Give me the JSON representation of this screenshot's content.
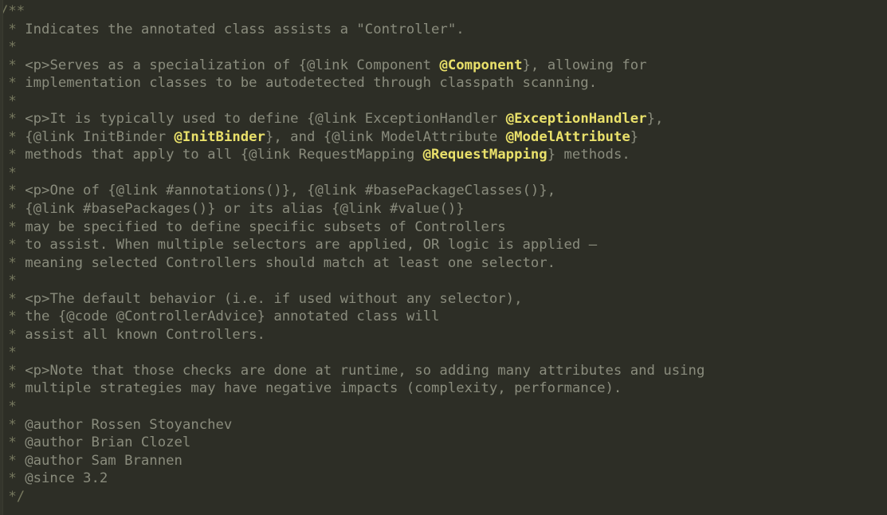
{
  "editor": {
    "kind": "code-editor-javadoc-comment",
    "language": "Java",
    "theme": "dark",
    "colors": {
      "background": "#2d2e26",
      "comment_text": "#8a8c7d",
      "comment_delimiter": "#77795f",
      "javadoc_tag": "#e0245e",
      "annotation_reference": "#e9e06a",
      "gutter_edge": "#34352c"
    }
  },
  "code": {
    "lines": [
      {
        "id": "line-1",
        "tokens": [
          {
            "t": "slash",
            "s": "/**"
          }
        ]
      },
      {
        "id": "line-2",
        "tokens": [
          {
            "t": "star",
            "s": " * "
          },
          {
            "t": "cmt",
            "s": "Indicates the annotated class assists a \"Controller\"."
          }
        ]
      },
      {
        "id": "line-3",
        "tokens": [
          {
            "t": "star",
            "s": " *"
          }
        ]
      },
      {
        "id": "line-4",
        "tokens": [
          {
            "t": "star",
            "s": " * "
          },
          {
            "t": "brk",
            "s": "<"
          },
          {
            "t": "tag",
            "s": "p"
          },
          {
            "t": "brk",
            "s": ">"
          },
          {
            "t": "cmt",
            "s": "Serves as a specialization of {"
          },
          {
            "t": "tag",
            "s": "@link"
          },
          {
            "t": "cmt",
            "s": " Component "
          },
          {
            "t": "anno",
            "s": "@Component"
          },
          {
            "t": "cmt",
            "s": "}, allowing for"
          }
        ]
      },
      {
        "id": "line-5",
        "tokens": [
          {
            "t": "star",
            "s": " * "
          },
          {
            "t": "cmt",
            "s": "implementation classes to be autodetected through classpath scanning."
          }
        ]
      },
      {
        "id": "line-6",
        "tokens": [
          {
            "t": "star",
            "s": " *"
          }
        ]
      },
      {
        "id": "line-7",
        "tokens": [
          {
            "t": "star",
            "s": " * "
          },
          {
            "t": "brk",
            "s": "<"
          },
          {
            "t": "tag",
            "s": "p"
          },
          {
            "t": "brk",
            "s": ">"
          },
          {
            "t": "cmt",
            "s": "It is typically used to define {"
          },
          {
            "t": "tag",
            "s": "@link"
          },
          {
            "t": "cmt",
            "s": " ExceptionHandler "
          },
          {
            "t": "anno",
            "s": "@ExceptionHandler"
          },
          {
            "t": "cmt",
            "s": "},"
          }
        ]
      },
      {
        "id": "line-8",
        "tokens": [
          {
            "t": "star",
            "s": " * "
          },
          {
            "t": "cmt",
            "s": "{"
          },
          {
            "t": "tag",
            "s": "@link"
          },
          {
            "t": "cmt",
            "s": " InitBinder "
          },
          {
            "t": "anno",
            "s": "@InitBinder"
          },
          {
            "t": "cmt",
            "s": "}, and {"
          },
          {
            "t": "tag",
            "s": "@link"
          },
          {
            "t": "cmt",
            "s": " ModelAttribute "
          },
          {
            "t": "anno",
            "s": "@ModelAttribute"
          },
          {
            "t": "cmt",
            "s": "}"
          }
        ]
      },
      {
        "id": "line-9",
        "tokens": [
          {
            "t": "star",
            "s": " * "
          },
          {
            "t": "cmt",
            "s": "methods that apply to all {"
          },
          {
            "t": "tag",
            "s": "@link"
          },
          {
            "t": "cmt",
            "s": " RequestMapping "
          },
          {
            "t": "anno",
            "s": "@RequestMapping"
          },
          {
            "t": "cmt",
            "s": "} methods."
          }
        ]
      },
      {
        "id": "line-10",
        "tokens": [
          {
            "t": "star",
            "s": " *"
          }
        ]
      },
      {
        "id": "line-11",
        "tokens": [
          {
            "t": "star",
            "s": " * "
          },
          {
            "t": "brk",
            "s": "<"
          },
          {
            "t": "tag",
            "s": "p"
          },
          {
            "t": "brk",
            "s": ">"
          },
          {
            "t": "cmt",
            "s": "One of {"
          },
          {
            "t": "tag",
            "s": "@link"
          },
          {
            "t": "cmt",
            "s": " #annotations()}, {"
          },
          {
            "t": "tag",
            "s": "@link"
          },
          {
            "t": "cmt",
            "s": " #basePackageClasses()},"
          }
        ]
      },
      {
        "id": "line-12",
        "tokens": [
          {
            "t": "star",
            "s": " * "
          },
          {
            "t": "cmt",
            "s": "{"
          },
          {
            "t": "tag",
            "s": "@link"
          },
          {
            "t": "cmt",
            "s": " #basePackages()} or its alias {"
          },
          {
            "t": "tag",
            "s": "@link"
          },
          {
            "t": "cmt",
            "s": " #value()}"
          }
        ]
      },
      {
        "id": "line-13",
        "tokens": [
          {
            "t": "star",
            "s": " * "
          },
          {
            "t": "cmt",
            "s": "may be specified to define specific subsets of Controllers"
          }
        ]
      },
      {
        "id": "line-14",
        "tokens": [
          {
            "t": "star",
            "s": " * "
          },
          {
            "t": "cmt",
            "s": "to assist. When multiple selectors are applied, OR logic is applied –"
          }
        ]
      },
      {
        "id": "line-15",
        "tokens": [
          {
            "t": "star",
            "s": " * "
          },
          {
            "t": "cmt",
            "s": "meaning selected Controllers should match at least one selector."
          }
        ]
      },
      {
        "id": "line-16",
        "tokens": [
          {
            "t": "star",
            "s": " *"
          }
        ]
      },
      {
        "id": "line-17",
        "tokens": [
          {
            "t": "star",
            "s": " * "
          },
          {
            "t": "brk",
            "s": "<"
          },
          {
            "t": "tag",
            "s": "p"
          },
          {
            "t": "brk",
            "s": ">"
          },
          {
            "t": "cmt",
            "s": "The default behavior (i.e. if used without any selector),"
          }
        ]
      },
      {
        "id": "line-18",
        "tokens": [
          {
            "t": "star",
            "s": " * "
          },
          {
            "t": "cmt",
            "s": "the {"
          },
          {
            "t": "tag",
            "s": "@code"
          },
          {
            "t": "cmt",
            "s": " @ControllerAdvice} annotated class will"
          }
        ]
      },
      {
        "id": "line-19",
        "tokens": [
          {
            "t": "star",
            "s": " * "
          },
          {
            "t": "cmt",
            "s": "assist all known Controllers."
          }
        ]
      },
      {
        "id": "line-20",
        "tokens": [
          {
            "t": "star",
            "s": " *"
          }
        ]
      },
      {
        "id": "line-21",
        "tokens": [
          {
            "t": "star",
            "s": " * "
          },
          {
            "t": "brk",
            "s": "<"
          },
          {
            "t": "tag",
            "s": "p"
          },
          {
            "t": "brk",
            "s": ">"
          },
          {
            "t": "cmt",
            "s": "Note that those checks are done at runtime, so adding many attributes and using"
          }
        ]
      },
      {
        "id": "line-22",
        "tokens": [
          {
            "t": "star",
            "s": " * "
          },
          {
            "t": "cmt",
            "s": "multiple strategies may have negative impacts (complexity, performance)."
          }
        ]
      },
      {
        "id": "line-23",
        "tokens": [
          {
            "t": "star",
            "s": " *"
          }
        ]
      },
      {
        "id": "line-24",
        "tokens": [
          {
            "t": "star",
            "s": " * "
          },
          {
            "t": "tag",
            "s": "@author"
          },
          {
            "t": "cmt",
            "s": " Rossen Stoyanchev"
          }
        ]
      },
      {
        "id": "line-25",
        "tokens": [
          {
            "t": "star",
            "s": " * "
          },
          {
            "t": "tag",
            "s": "@author"
          },
          {
            "t": "cmt",
            "s": " Brian Clozel"
          }
        ]
      },
      {
        "id": "line-26",
        "tokens": [
          {
            "t": "star",
            "s": " * "
          },
          {
            "t": "tag",
            "s": "@author"
          },
          {
            "t": "cmt",
            "s": " Sam Brannen"
          }
        ]
      },
      {
        "id": "line-27",
        "tokens": [
          {
            "t": "star",
            "s": " * "
          },
          {
            "t": "tag",
            "s": "@since"
          },
          {
            "t": "cmt",
            "s": " 3.2"
          }
        ]
      },
      {
        "id": "line-28",
        "tokens": [
          {
            "t": "slash",
            "s": " */"
          }
        ]
      }
    ]
  }
}
